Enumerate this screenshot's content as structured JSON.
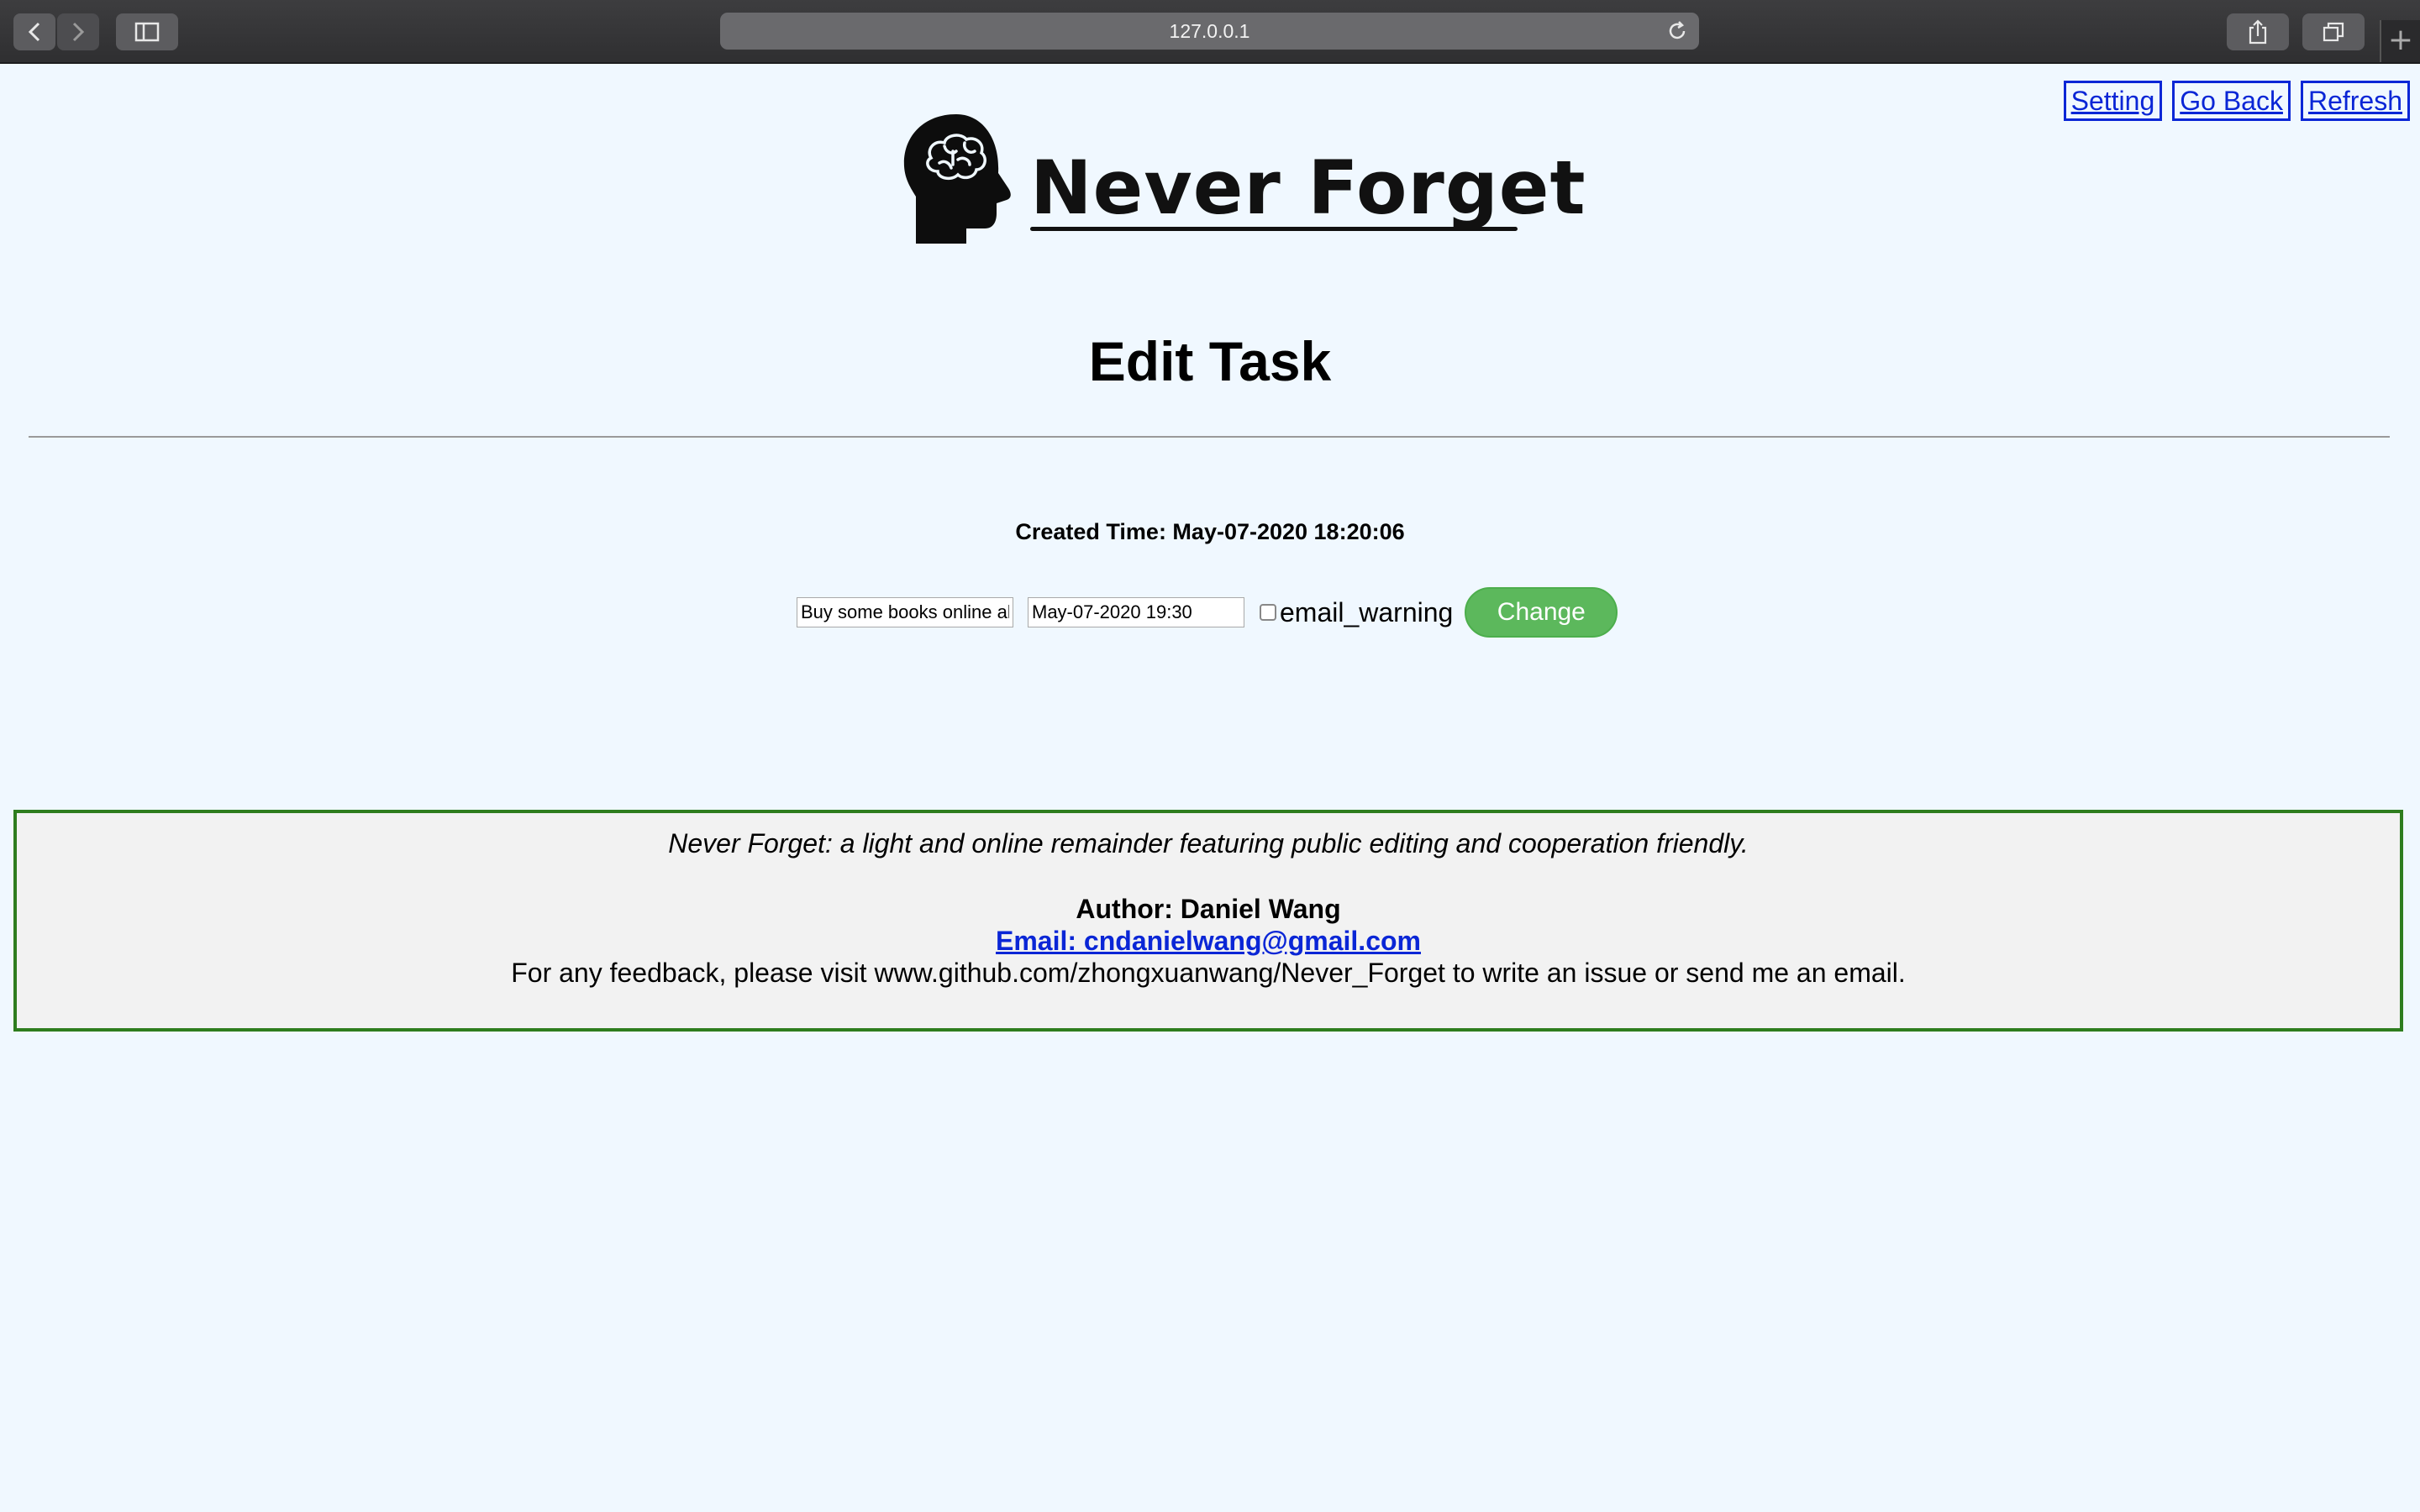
{
  "browser": {
    "url": "127.0.0.1",
    "icons": [
      "back-icon",
      "forward-icon",
      "sidebar-icon",
      "reload-icon",
      "share-icon",
      "tabs-icon",
      "plus-icon"
    ]
  },
  "nav": {
    "setting": "Setting",
    "go_back": "Go Back",
    "refresh": "Refresh"
  },
  "logo": {
    "text": "Never Forget",
    "icon": "brain-head-icon"
  },
  "page": {
    "title": "Edit Task",
    "created_time": "Created Time: May-07-2020 18:20:06"
  },
  "form": {
    "task_value": "Buy some books online al",
    "time_value": "May-07-2020 19:30",
    "email_warning_label": "email_warning",
    "email_warning_checked": false,
    "change_label": "Change"
  },
  "footer": {
    "tagline": "Never Forget: a light and online remainder featuring public editing and cooperation friendly.",
    "author": "Author: Daniel Wang",
    "email": "Email: cndanielwang@gmail.com",
    "feedback": "For any feedback, please visit www.github.com/zhongxuanwang/Never_Forget to write an issue or send me an email."
  },
  "colors": {
    "page_bg": "#f0f8ff",
    "link_blue": "#0a26d6",
    "button_green": "#5cb85c",
    "footer_border": "#2e7d1e",
    "footer_bg": "#f2f2f2"
  }
}
